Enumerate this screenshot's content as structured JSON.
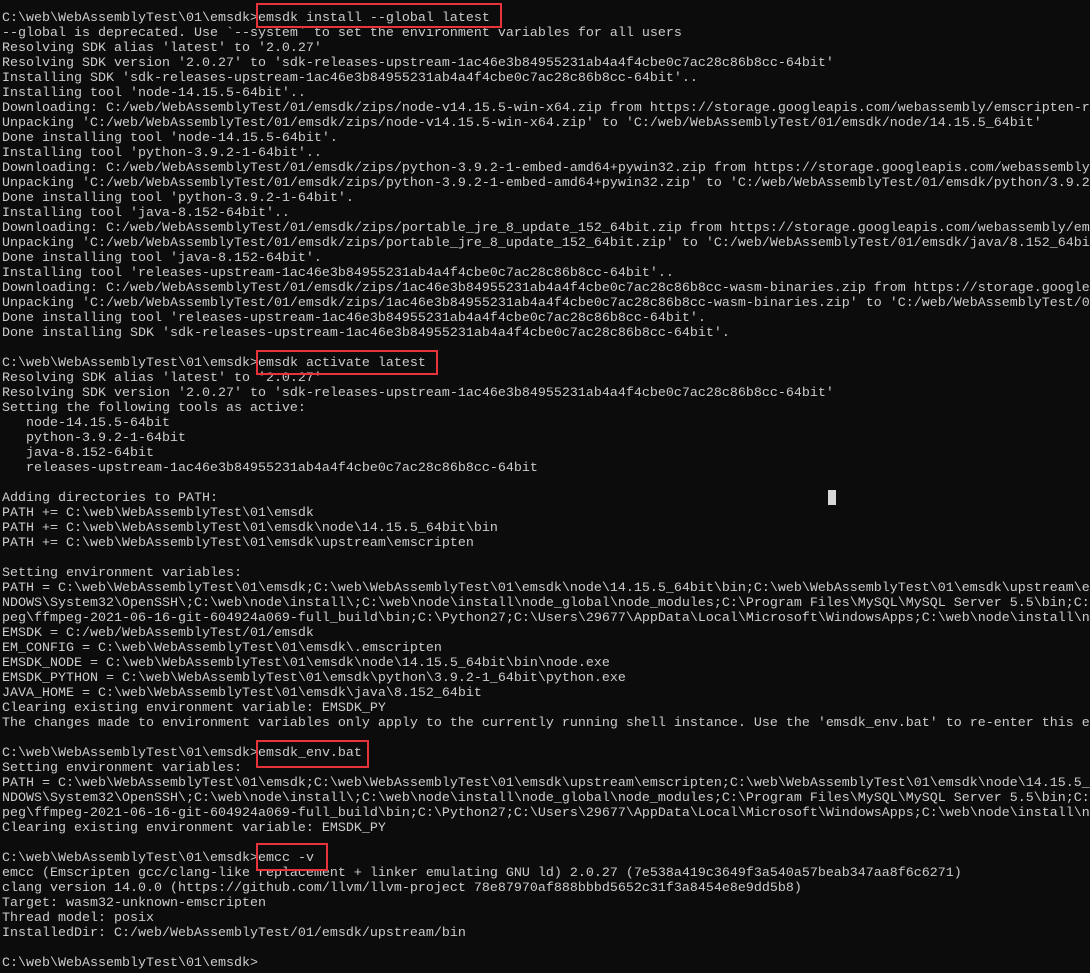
{
  "window": {
    "type": "windows-command-prompt",
    "background": "#0c0c0c",
    "text_color": "#cccccc",
    "highlight_color": "#e8333a"
  },
  "prompt": "C:\\web\\WebAssemblyTest\\01\\emsdk>",
  "lines": [
    {
      "prompt": "C:\\web\\WebAssemblyTest\\01\\emsdk>",
      "command": "emsdk install --global latest"
    },
    {
      "text": "--global is deprecated. Use `--system` to set the environment variables for all users"
    },
    {
      "text": "Resolving SDK alias 'latest' to '2.0.27'"
    },
    {
      "text": "Resolving SDK version '2.0.27' to 'sdk-releases-upstream-1ac46e3b84955231ab4a4f4cbe0c7ac28c86b8cc-64bit'"
    },
    {
      "text": "Installing SDK 'sdk-releases-upstream-1ac46e3b84955231ab4a4f4cbe0c7ac28c86b8cc-64bit'.."
    },
    {
      "text": "Installing tool 'node-14.15.5-64bit'.."
    },
    {
      "text": "Downloading: C:/web/WebAssemblyTest/01/emsdk/zips/node-v14.15.5-win-x64.zip from https://storage.googleapis.com/webassembly/emscripten-r"
    },
    {
      "text": "Unpacking 'C:/web/WebAssemblyTest/01/emsdk/zips/node-v14.15.5-win-x64.zip' to 'C:/web/WebAssemblyTest/01/emsdk/node/14.15.5_64bit'"
    },
    {
      "text": "Done installing tool 'node-14.15.5-64bit'."
    },
    {
      "text": "Installing tool 'python-3.9.2-1-64bit'.."
    },
    {
      "text": "Downloading: C:/web/WebAssemblyTest/01/emsdk/zips/python-3.9.2-1-embed-amd64+pywin32.zip from https://storage.googleapis.com/webassembly"
    },
    {
      "text": "Unpacking 'C:/web/WebAssemblyTest/01/emsdk/zips/python-3.9.2-1-embed-amd64+pywin32.zip' to 'C:/web/WebAssemblyTest/01/emsdk/python/3.9.2"
    },
    {
      "text": "Done installing tool 'python-3.9.2-1-64bit'."
    },
    {
      "text": "Installing tool 'java-8.152-64bit'.."
    },
    {
      "text": "Downloading: C:/web/WebAssemblyTest/01/emsdk/zips/portable_jre_8_update_152_64bit.zip from https://storage.googleapis.com/webassembly/em"
    },
    {
      "text": "Unpacking 'C:/web/WebAssemblyTest/01/emsdk/zips/portable_jre_8_update_152_64bit.zip' to 'C:/web/WebAssemblyTest/01/emsdk/java/8.152_64bi"
    },
    {
      "text": "Done installing tool 'java-8.152-64bit'."
    },
    {
      "text": "Installing tool 'releases-upstream-1ac46e3b84955231ab4a4f4cbe0c7ac28c86b8cc-64bit'.."
    },
    {
      "text": "Downloading: C:/web/WebAssemblyTest/01/emsdk/zips/1ac46e3b84955231ab4a4f4cbe0c7ac28c86b8cc-wasm-binaries.zip from https://storage.google"
    },
    {
      "text": "Unpacking 'C:/web/WebAssemblyTest/01/emsdk/zips/1ac46e3b84955231ab4a4f4cbe0c7ac28c86b8cc-wasm-binaries.zip' to 'C:/web/WebAssemblyTest/0"
    },
    {
      "text": "Done installing tool 'releases-upstream-1ac46e3b84955231ab4a4f4cbe0c7ac28c86b8cc-64bit'."
    },
    {
      "text": "Done installing SDK 'sdk-releases-upstream-1ac46e3b84955231ab4a4f4cbe0c7ac28c86b8cc-64bit'."
    },
    {
      "text": ""
    },
    {
      "prompt": "C:\\web\\WebAssemblyTest\\01\\emsdk>",
      "command": "emsdk activate latest"
    },
    {
      "text": "Resolving SDK alias 'latest' to '2.0.27'"
    },
    {
      "text": "Resolving SDK version '2.0.27' to 'sdk-releases-upstream-1ac46e3b84955231ab4a4f4cbe0c7ac28c86b8cc-64bit'"
    },
    {
      "text": "Setting the following tools as active:"
    },
    {
      "text": "   node-14.15.5-64bit"
    },
    {
      "text": "   python-3.9.2-1-64bit"
    },
    {
      "text": "   java-8.152-64bit"
    },
    {
      "text": "   releases-upstream-1ac46e3b84955231ab4a4f4cbe0c7ac28c86b8cc-64bit"
    },
    {
      "text": ""
    },
    {
      "text": "Adding directories to PATH:"
    },
    {
      "text": "PATH += C:\\web\\WebAssemblyTest\\01\\emsdk"
    },
    {
      "text": "PATH += C:\\web\\WebAssemblyTest\\01\\emsdk\\node\\14.15.5_64bit\\bin"
    },
    {
      "text": "PATH += C:\\web\\WebAssemblyTest\\01\\emsdk\\upstream\\emscripten"
    },
    {
      "text": ""
    },
    {
      "text": "Setting environment variables:"
    },
    {
      "text": "PATH = C:\\web\\WebAssemblyTest\\01\\emsdk;C:\\web\\WebAssemblyTest\\01\\emsdk\\node\\14.15.5_64bit\\bin;C:\\web\\WebAssemblyTest\\01\\emsdk\\upstream\\e"
    },
    {
      "text": "NDOWS\\System32\\OpenSSH\\;C:\\web\\node\\install\\;C:\\web\\node\\install\\node_global\\node_modules;C:\\Program Files\\MySQL\\MySQL Server 5.5\\bin;C:"
    },
    {
      "text": "peg\\ffmpeg-2021-06-16-git-604924a069-full_build\\bin;C:\\Python27;C:\\Users\\29677\\AppData\\Local\\Microsoft\\WindowsApps;C:\\web\\node\\install\\n"
    },
    {
      "text": "EMSDK = C:/web/WebAssemblyTest/01/emsdk"
    },
    {
      "text": "EM_CONFIG = C:\\web\\WebAssemblyTest\\01\\emsdk\\.emscripten"
    },
    {
      "text": "EMSDK_NODE = C:\\web\\WebAssemblyTest\\01\\emsdk\\node\\14.15.5_64bit\\bin\\node.exe"
    },
    {
      "text": "EMSDK_PYTHON = C:\\web\\WebAssemblyTest\\01\\emsdk\\python\\3.9.2-1_64bit\\python.exe"
    },
    {
      "text": "JAVA_HOME = C:\\web\\WebAssemblyTest\\01\\emsdk\\java\\8.152_64bit"
    },
    {
      "text": "Clearing existing environment variable: EMSDK_PY"
    },
    {
      "text": "The changes made to environment variables only apply to the currently running shell instance. Use the 'emsdk_env.bat' to re-enter this e"
    },
    {
      "text": ""
    },
    {
      "prompt": "C:\\web\\WebAssemblyTest\\01\\emsdk>",
      "command": "emsdk_env.bat"
    },
    {
      "text": "Setting environment variables:"
    },
    {
      "text": "PATH = C:\\web\\WebAssemblyTest\\01\\emsdk;C:\\web\\WebAssemblyTest\\01\\emsdk\\upstream\\emscripten;C:\\web\\WebAssemblyTest\\01\\emsdk\\node\\14.15.5_"
    },
    {
      "text": "NDOWS\\System32\\OpenSSH\\;C:\\web\\node\\install\\;C:\\web\\node\\install\\node_global\\node_modules;C:\\Program Files\\MySQL\\MySQL Server 5.5\\bin;C:"
    },
    {
      "text": "peg\\ffmpeg-2021-06-16-git-604924a069-full_build\\bin;C:\\Python27;C:\\Users\\29677\\AppData\\Local\\Microsoft\\WindowsApps;C:\\web\\node\\install\\n"
    },
    {
      "text": "Clearing existing environment variable: EMSDK_PY"
    },
    {
      "text": ""
    },
    {
      "prompt": "C:\\web\\WebAssemblyTest\\01\\emsdk>",
      "command": "emcc -v"
    },
    {
      "text": "emcc (Emscripten gcc/clang-like replacement + linker emulating GNU ld) 2.0.27 (7e538a419c3649f3a540a57beab347aa8f6c6271)"
    },
    {
      "text": "clang version 14.0.0 (https://github.com/llvm/llvm-project 78e87970af888bbbd5652c31f3a8454e8e9dd5b8)"
    },
    {
      "text": "Target: wasm32-unknown-emscripten"
    },
    {
      "text": "Thread model: posix"
    },
    {
      "text": "InstalledDir: C:/web/WebAssemblyTest/01/emsdk/upstream/bin"
    },
    {
      "text": ""
    },
    {
      "prompt": "C:\\web\\WebAssemblyTest\\01\\emsdk>",
      "command": ""
    }
  ]
}
